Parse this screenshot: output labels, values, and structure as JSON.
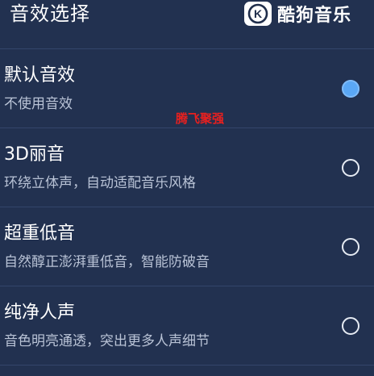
{
  "header": {
    "title": "音效选择",
    "logo_text": "酷狗音乐",
    "logo_letter": "K"
  },
  "options": [
    {
      "title": "默认音效",
      "description": "不使用音效",
      "selected": true
    },
    {
      "title": "3D丽音",
      "description": "环绕立体声，自动适配音乐风格",
      "selected": false
    },
    {
      "title": "超重低音",
      "description": "自然醇正澎湃重低音，智能防破音",
      "selected": false
    },
    {
      "title": "纯净人声",
      "description": "音色明亮通透，突出更多人声细节",
      "selected": false
    }
  ],
  "watermark": "腾飞聚强",
  "colors": {
    "background": "#223150",
    "divider": "#33456a",
    "accent": "#5aa7f5",
    "watermark": "#e8201f"
  }
}
